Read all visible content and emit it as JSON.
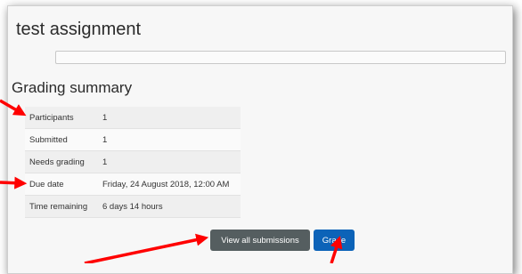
{
  "assignment": {
    "title": "test assignment"
  },
  "summary": {
    "heading": "Grading summary",
    "rows": [
      {
        "label": "Participants",
        "value": "1"
      },
      {
        "label": "Submitted",
        "value": "1"
      },
      {
        "label": "Needs grading",
        "value": "1"
      },
      {
        "label": "Due date",
        "value": "Friday, 24 August 2018, 12:00 AM"
      },
      {
        "label": "Time remaining",
        "value": "6 days 14 hours"
      }
    ]
  },
  "actions": {
    "view_all_label": "View all submissions",
    "grade_label": "Grade"
  },
  "colors": {
    "arrow": "#ff0000",
    "grade_button": "#0c63b8",
    "view_button": "#555e60"
  }
}
